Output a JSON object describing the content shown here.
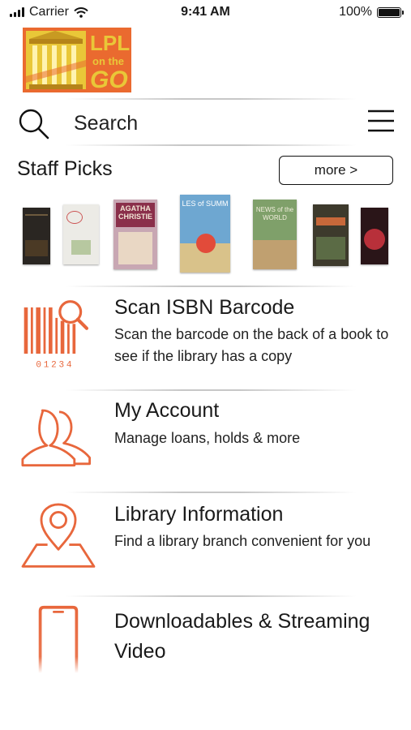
{
  "status_bar": {
    "carrier": "Carrier",
    "time": "9:41 AM",
    "battery": "100%"
  },
  "logo": {
    "text_line1": "LPL",
    "text_line2": "on the",
    "text_line3": "GO"
  },
  "search": {
    "label": "Search"
  },
  "staff_picks": {
    "title": "Staff Picks",
    "more_label": "more >",
    "books": [
      {
        "id": "book-1",
        "color": "#2a2622"
      },
      {
        "id": "book-2",
        "color": "#ecebe6"
      },
      {
        "id": "book-3",
        "color": "#c8a7b3",
        "title_text": "AGATHA CHRISTIE"
      },
      {
        "id": "book-4",
        "color": "#6ea7d1",
        "title_text": "LES of SUMM"
      },
      {
        "id": "book-5",
        "color": "#7fa06a",
        "title_text": "NEWS of the WORLD"
      },
      {
        "id": "book-6",
        "color": "#3d3a2c"
      },
      {
        "id": "book-7",
        "color": "#2a1518"
      }
    ]
  },
  "menu_items": [
    {
      "title": "Scan ISBN Barcode",
      "description": "Scan the barcode on the back of a book to see if the library has a copy",
      "icon": "barcode-icon",
      "barcode_digits": "01234"
    },
    {
      "title": "My Account",
      "description": "Manage loans, holds & more",
      "icon": "users-icon"
    },
    {
      "title": "Library Information",
      "description": "Find a library branch convenient for you",
      "icon": "map-pin-icon"
    },
    {
      "title": "Downloadables & Streaming Video",
      "description": "",
      "icon": "phone-icon"
    }
  ],
  "colors": {
    "accent": "#e8673c",
    "logo_orange": "#ea6a2f",
    "logo_yellow": "#e9c738"
  }
}
